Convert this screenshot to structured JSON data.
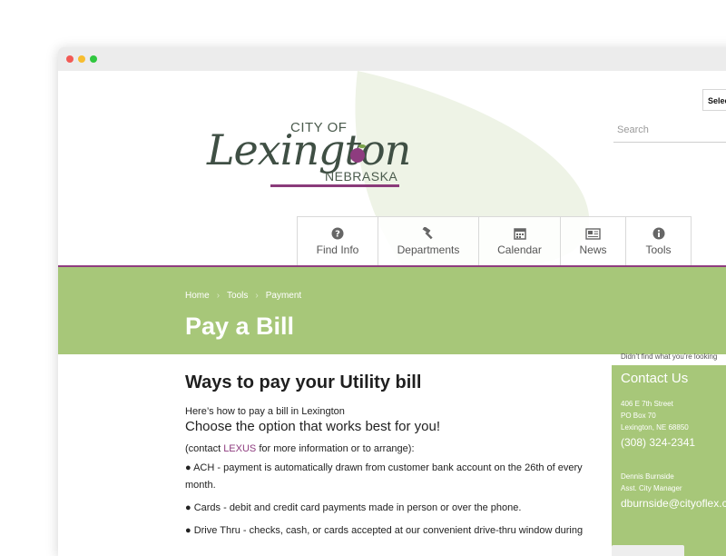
{
  "header": {
    "logo": {
      "city_of": "CITY OF",
      "name": "Lexington",
      "state": "NEBRASKA"
    },
    "select_label": "Selec",
    "search_placeholder": "Search"
  },
  "nav": [
    {
      "label": "Find Info",
      "icon": "question-circle-icon"
    },
    {
      "label": "Departments",
      "icon": "gavel-icon"
    },
    {
      "label": "Calendar",
      "icon": "calendar-icon"
    },
    {
      "label": "News",
      "icon": "newspaper-icon"
    },
    {
      "label": "Tools",
      "icon": "info-circle-icon"
    }
  ],
  "breadcrumb": [
    "Home",
    "Tools",
    "Payment"
  ],
  "page_title": "Pay a Bill",
  "content": {
    "heading": "Ways to pay your Utility bill",
    "intro": "Here’s how to pay a bill in Lexington",
    "lead": "Choose the option that works best for you!",
    "contact_prefix": "(contact ",
    "contact_link": "LEXUS",
    "contact_suffix": " for more information or to arrange):",
    "bullets": [
      "● ACH - payment is automatically drawn from customer bank account on the 26th of every month.",
      "● Cards - debit and credit card payments made in person or over the phone.",
      "● Drive Thru - checks, cash, or cards accepted at our convenient drive-thru window during"
    ]
  },
  "sidebar": {
    "note": "Didn’t find what you’re looking",
    "title": "Contact Us",
    "address": [
      "406 E 7th Street",
      "PO Box 70",
      "Lexington, NE 68850"
    ],
    "phone": "(308) 324-2341",
    "person": "Dennis Burnside",
    "role": "Asst. City Manager",
    "email": "dburnside@cityoflex.com"
  },
  "colors": {
    "accent_green": "#a7c779",
    "accent_purple": "#8e3c7f",
    "logo_green": "#3f4f44"
  }
}
